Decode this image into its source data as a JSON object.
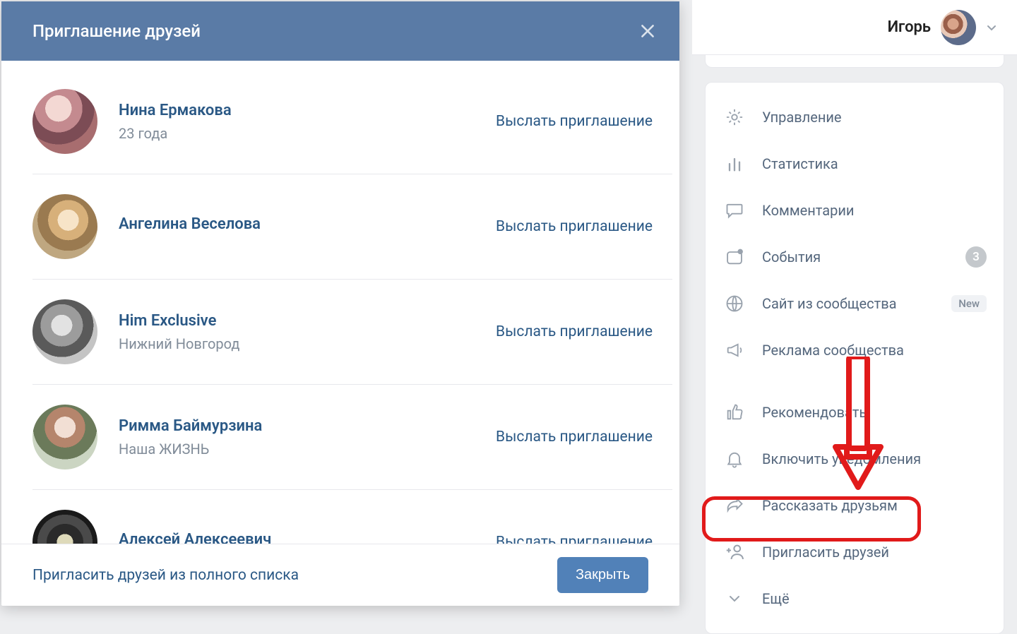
{
  "profile": {
    "name": "Игорь"
  },
  "sidebar": {
    "items": [
      {
        "icon": "gear",
        "label": "Управление"
      },
      {
        "icon": "stats",
        "label": "Статистика"
      },
      {
        "icon": "comment",
        "label": "Комментарии"
      },
      {
        "icon": "bell-card",
        "label": "События",
        "count": "3"
      },
      {
        "icon": "globe",
        "label": "Сайт из сообщества",
        "new_badge": "New"
      },
      {
        "icon": "megaphone",
        "label": "Реклама сообщества"
      },
      {
        "icon": "thumb",
        "label": "Рекомендовать"
      },
      {
        "icon": "bell",
        "label": "Включить уведомления"
      },
      {
        "icon": "share",
        "label": "Рассказать друзьям"
      },
      {
        "icon": "add-user",
        "label": "Пригласить друзей"
      },
      {
        "icon": "chevron",
        "label": "Ещё"
      }
    ]
  },
  "modal": {
    "title": "Приглашение друзей",
    "invite_action": "Выслать приглашение",
    "footer_link": "Пригласить друзей из полного списка",
    "close_button": "Закрыть",
    "friends": [
      {
        "name": "Нина Ермакова",
        "sub": "23 года"
      },
      {
        "name": "Ангелина Веселова",
        "sub": ""
      },
      {
        "name": "Him Exclusive",
        "sub": "Нижний Новгород"
      },
      {
        "name": "Римма Баймурзина",
        "sub": "Наша ЖИЗНЬ"
      },
      {
        "name": "Алексей Алексеевич",
        "sub": ""
      }
    ]
  }
}
